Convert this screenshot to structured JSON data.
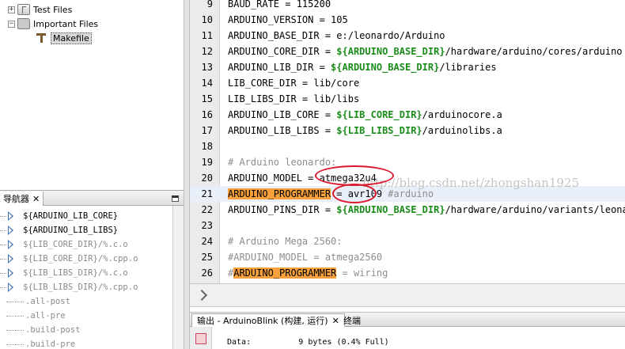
{
  "project_tree": {
    "items": [
      {
        "label": "Test Files",
        "expander": "+",
        "icon": "files-icon"
      },
      {
        "label": "Important Files",
        "expander": "−",
        "icon": "folder-icon"
      },
      {
        "label": "Makefile",
        "expander": "",
        "icon": "make-icon"
      }
    ]
  },
  "navigator": {
    "tab_title": "导航器",
    "close_glyph": "✕",
    "items": [
      {
        "label": "${ARDUINO_LIB_CORE}",
        "style": "bold",
        "expandable": true
      },
      {
        "label": "${ARDUINO_LIB_LIBS}",
        "style": "bold",
        "expandable": true
      },
      {
        "label": "${LIB_CORE_DIR}/%.c.o",
        "style": "gray",
        "expandable": true
      },
      {
        "label": "${LIB_CORE_DIR}/%.cpp.o",
        "style": "gray",
        "expandable": true
      },
      {
        "label": "${LIB_LIBS_DIR}/%.c.o",
        "style": "gray",
        "expandable": true
      },
      {
        "label": "${LIB_LIBS_DIR}/%.cpp.o",
        "style": "gray",
        "expandable": true
      },
      {
        "label": ".all-post",
        "style": "gray",
        "expandable": false
      },
      {
        "label": ".all-pre",
        "style": "gray",
        "expandable": false
      },
      {
        "label": ".build-post",
        "style": "gray",
        "expandable": false
      },
      {
        "label": ".build-pre",
        "style": "gray",
        "expandable": false
      }
    ]
  },
  "editor": {
    "current_line": 21,
    "lines": [
      {
        "n": "9",
        "parts": [
          {
            "t": "BAUD_RATE = 115200",
            "c": ""
          }
        ]
      },
      {
        "n": "10",
        "parts": [
          {
            "t": "ARDUINO_VERSION = 105",
            "c": ""
          }
        ]
      },
      {
        "n": "11",
        "parts": [
          {
            "t": "ARDUINO_BASE_DIR = e:/leonardo/Arduino",
            "c": ""
          }
        ]
      },
      {
        "n": "12",
        "parts": [
          {
            "t": "ARDUINO_CORE_DIR = ",
            "c": ""
          },
          {
            "t": "${ARDUINO_BASE_DIR}",
            "c": "var"
          },
          {
            "t": "/hardware/arduino/cores/arduino",
            "c": ""
          }
        ]
      },
      {
        "n": "13",
        "parts": [
          {
            "t": "ARDUINO_LIB_DIR = ",
            "c": ""
          },
          {
            "t": "${ARDUINO_BASE_DIR}",
            "c": "var"
          },
          {
            "t": "/libraries",
            "c": ""
          }
        ]
      },
      {
        "n": "14",
        "parts": [
          {
            "t": "LIB_CORE_DIR = lib/core",
            "c": ""
          }
        ]
      },
      {
        "n": "15",
        "parts": [
          {
            "t": "LIB_LIBS_DIR = lib/libs",
            "c": ""
          }
        ]
      },
      {
        "n": "16",
        "parts": [
          {
            "t": "ARDUINO_LIB_CORE = ",
            "c": ""
          },
          {
            "t": "${LIB_CORE_DIR}",
            "c": "var"
          },
          {
            "t": "/arduinocore.a",
            "c": ""
          }
        ]
      },
      {
        "n": "17",
        "parts": [
          {
            "t": "ARDUINO_LIB_LIBS = ",
            "c": ""
          },
          {
            "t": "${LIB_LIBS_DIR}",
            "c": "var"
          },
          {
            "t": "/arduinolibs.a",
            "c": ""
          }
        ]
      },
      {
        "n": "18",
        "parts": []
      },
      {
        "n": "19",
        "parts": [
          {
            "t": "# Arduino leonardo:",
            "c": "cm"
          }
        ]
      },
      {
        "n": "20",
        "parts": [
          {
            "t": "ARDUINO_MODEL = atmega32u4",
            "c": ""
          }
        ]
      },
      {
        "n": "21",
        "parts": [
          {
            "t": "ARDUINO_PROGRAMMER",
            "c": "hl"
          },
          {
            "t": " = avr109 ",
            "c": ""
          },
          {
            "t": "#arduino",
            "c": "cm"
          }
        ]
      },
      {
        "n": "22",
        "parts": [
          {
            "t": "ARDUINO_PINS_DIR = ",
            "c": ""
          },
          {
            "t": "${ARDUINO_BASE_DIR}",
            "c": "var"
          },
          {
            "t": "/hardware/arduino/variants/leonardo",
            "c": ""
          }
        ]
      },
      {
        "n": "23",
        "parts": []
      },
      {
        "n": "24",
        "parts": [
          {
            "t": "# Arduino Mega 2560:",
            "c": "cm"
          }
        ]
      },
      {
        "n": "25",
        "parts": [
          {
            "t": "#ARDUINO_MODEL = atmega2560",
            "c": "cm"
          }
        ]
      },
      {
        "n": "26",
        "parts": [
          {
            "t": "#",
            "c": "cm"
          },
          {
            "t": "ARDUINO_PROGRAMMER",
            "c": "hl"
          },
          {
            "t": " = wiring",
            "c": "cm"
          }
        ]
      }
    ]
  },
  "watermark": "http://blog.csdn.net/zhongshan1925",
  "output_panel": {
    "tabs": [
      {
        "label": "输出 - ArduinoBlink (构建, 运行)",
        "active": true,
        "closable": true
      },
      {
        "label": "终端",
        "active": false,
        "closable": false
      }
    ],
    "close_glyph": "✕",
    "line": "Data:          9 bytes (0.4% Full)"
  },
  "colors": {
    "variable": "#1a8c1a",
    "comment": "#8d8d8d",
    "highlight": "#f7a03c",
    "annotation_ring": "#d9182e"
  }
}
